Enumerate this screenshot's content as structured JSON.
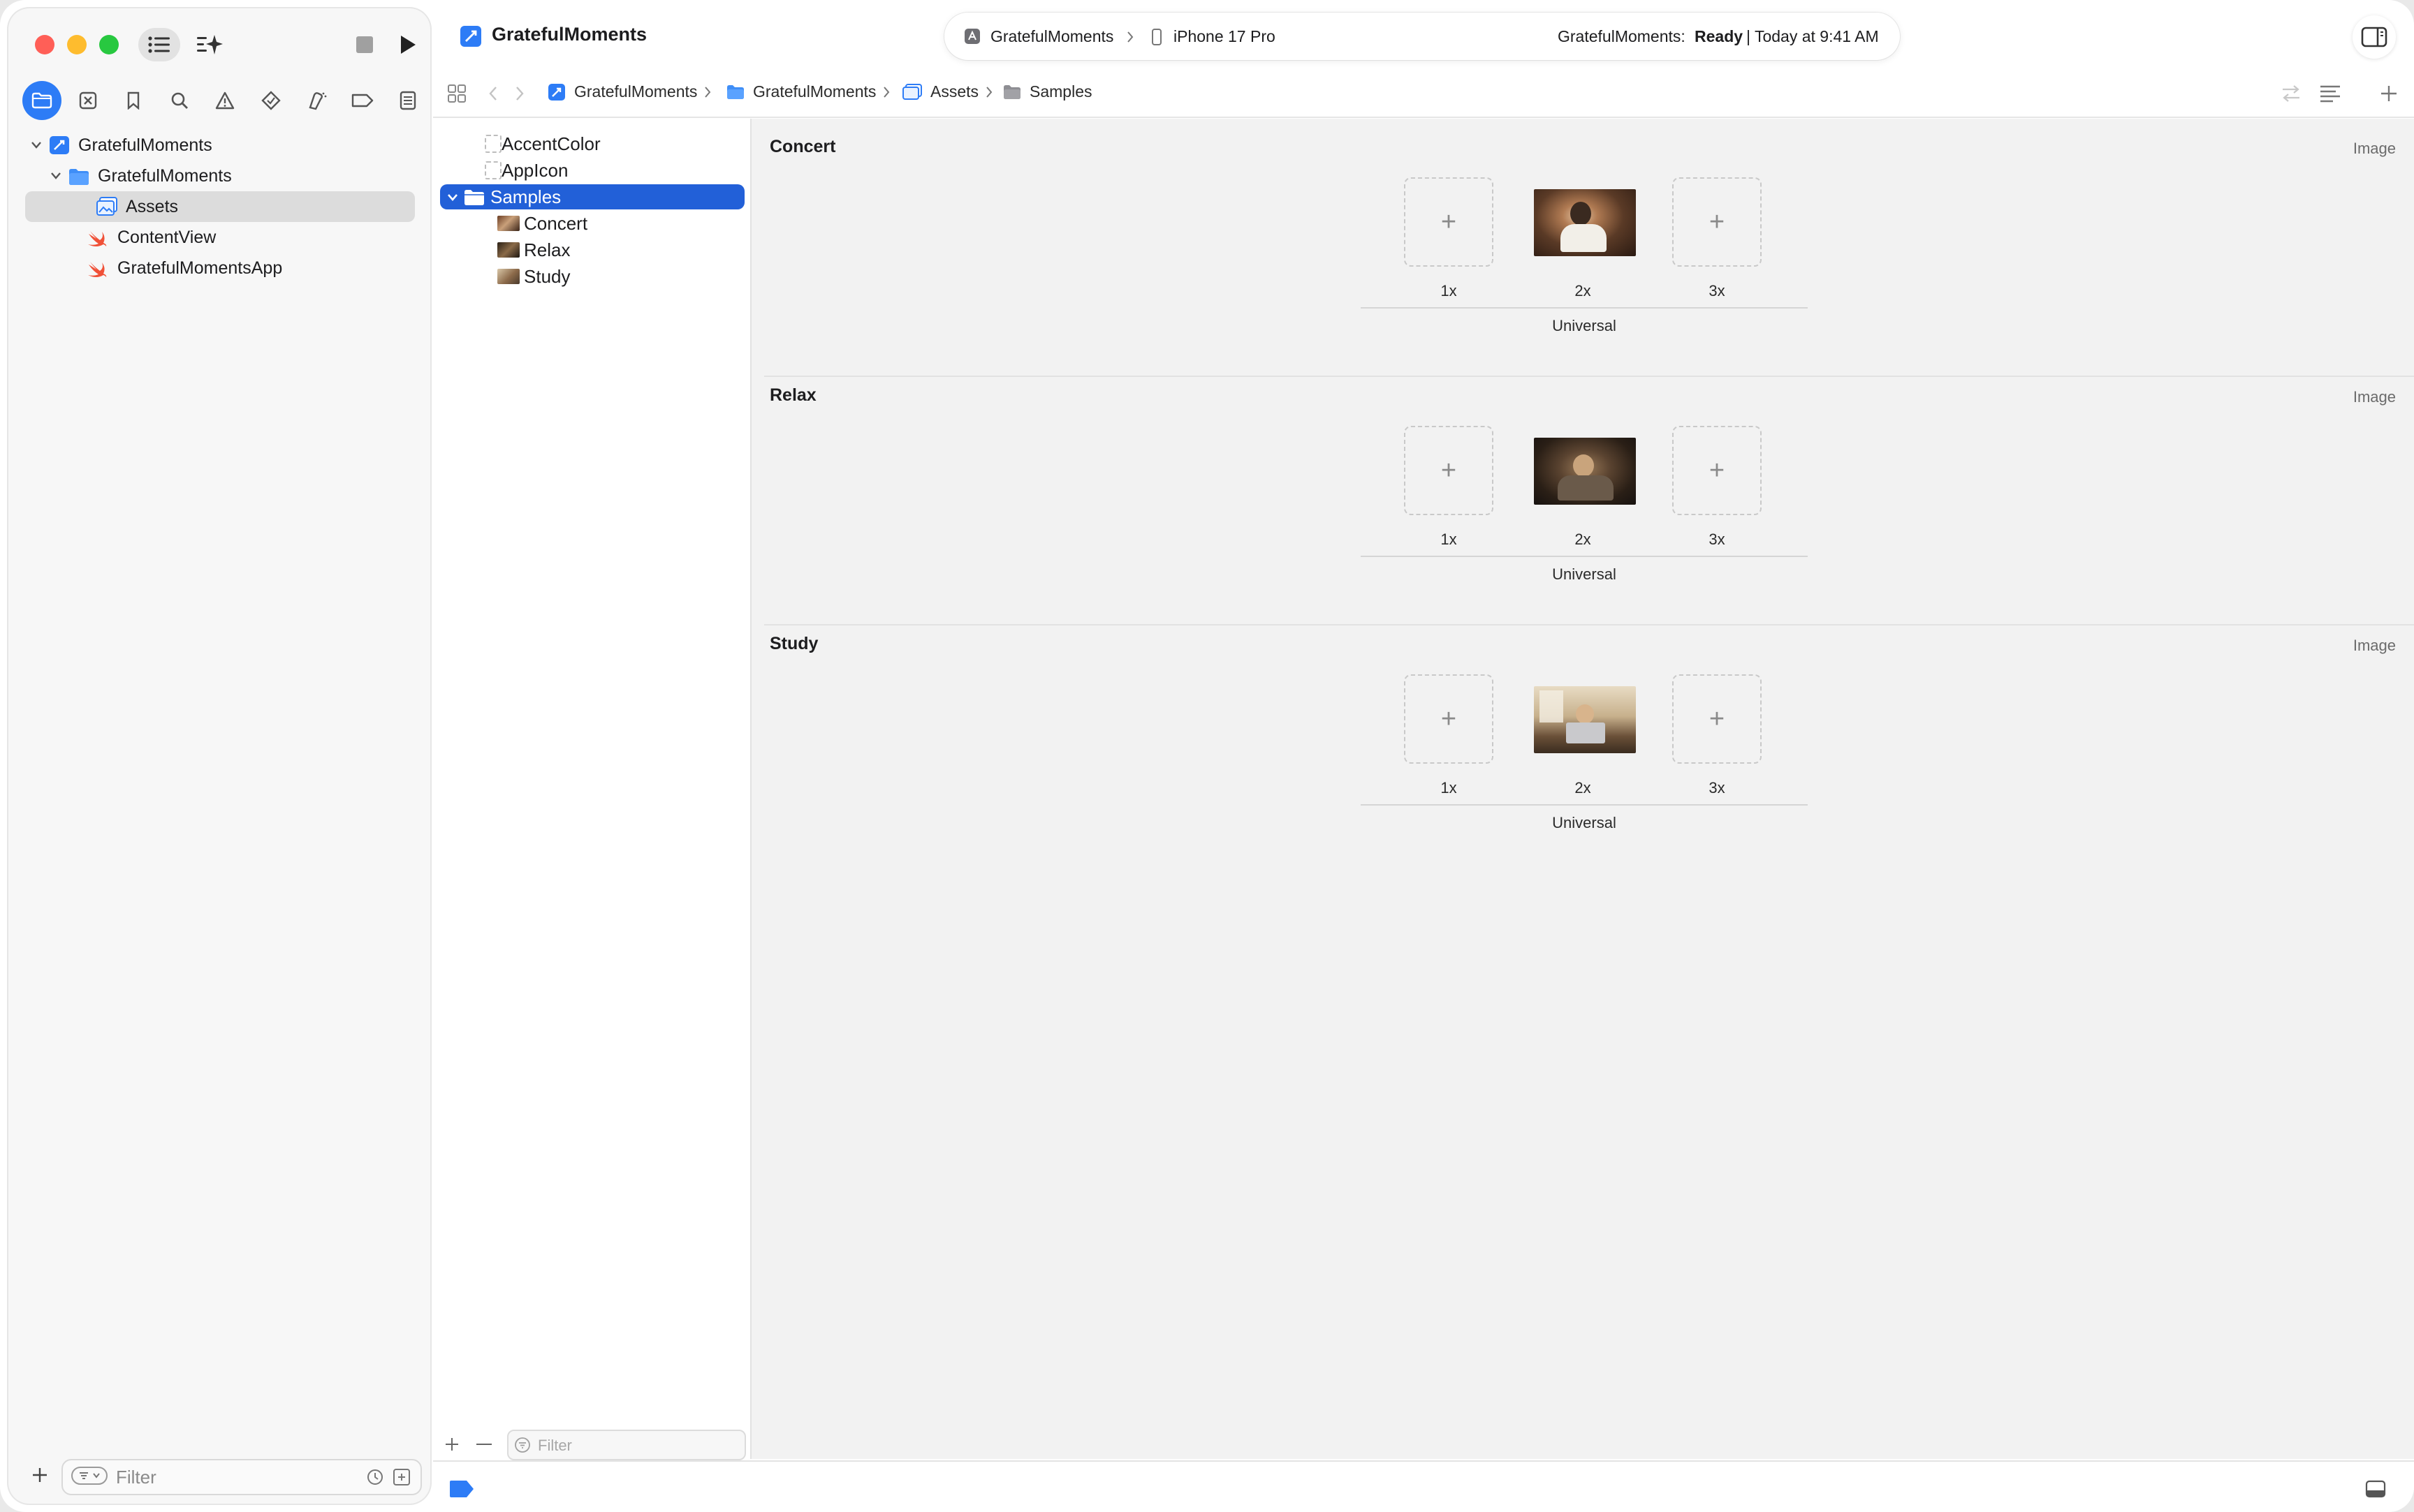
{
  "window": {
    "title": "GratefulMoments"
  },
  "activity": {
    "scheme": "GratefulMoments",
    "destination": "iPhone 17 Pro",
    "status_prefix": "GratefulMoments:",
    "status_state": "Ready",
    "status_time": "| Today at 9:41 AM"
  },
  "sidebar": {
    "nav_icons": [
      "folder-icon",
      "source-control-icon",
      "bookmark-icon",
      "search-icon",
      "warning-icon",
      "test-diamond-icon",
      "debug-spray-icon",
      "breakpoint-icon",
      "report-icon"
    ],
    "tree": [
      {
        "label": "GratefulMoments",
        "kind": "project",
        "level": 0
      },
      {
        "label": "GratefulMoments",
        "kind": "folder",
        "level": 1
      },
      {
        "label": "Assets",
        "kind": "assets",
        "level": 2,
        "selected": true
      },
      {
        "label": "ContentView",
        "kind": "swift",
        "level": 2
      },
      {
        "label": "GratefulMomentsApp",
        "kind": "swift",
        "level": 2
      }
    ],
    "filter_placeholder": "Filter"
  },
  "jumpbar": {
    "crumbs": [
      "GratefulMoments",
      "GratefulMoments",
      "Assets",
      "Samples"
    ]
  },
  "asset_list": {
    "items": [
      {
        "label": "AccentColor",
        "kind": "color"
      },
      {
        "label": "AppIcon",
        "kind": "appicon"
      },
      {
        "label": "Samples",
        "kind": "folder",
        "selected": true
      },
      {
        "label": "Concert",
        "kind": "image"
      },
      {
        "label": "Relax",
        "kind": "image"
      },
      {
        "label": "Study",
        "kind": "image"
      }
    ],
    "filter_placeholder": "Filter"
  },
  "editor": {
    "sets": [
      {
        "name": "Concert",
        "type": "Image",
        "scales": [
          "1x",
          "2x",
          "3x"
        ],
        "group": "Universal"
      },
      {
        "name": "Relax",
        "type": "Image",
        "scales": [
          "1x",
          "2x",
          "3x"
        ],
        "group": "Universal"
      },
      {
        "name": "Study",
        "type": "Image",
        "scales": [
          "1x",
          "2x",
          "3x"
        ],
        "group": "Universal"
      }
    ],
    "add_glyph": "+"
  },
  "colors": {
    "accent": "#2d7cf6",
    "selection": "#2260d8",
    "swift": "#f05138"
  }
}
